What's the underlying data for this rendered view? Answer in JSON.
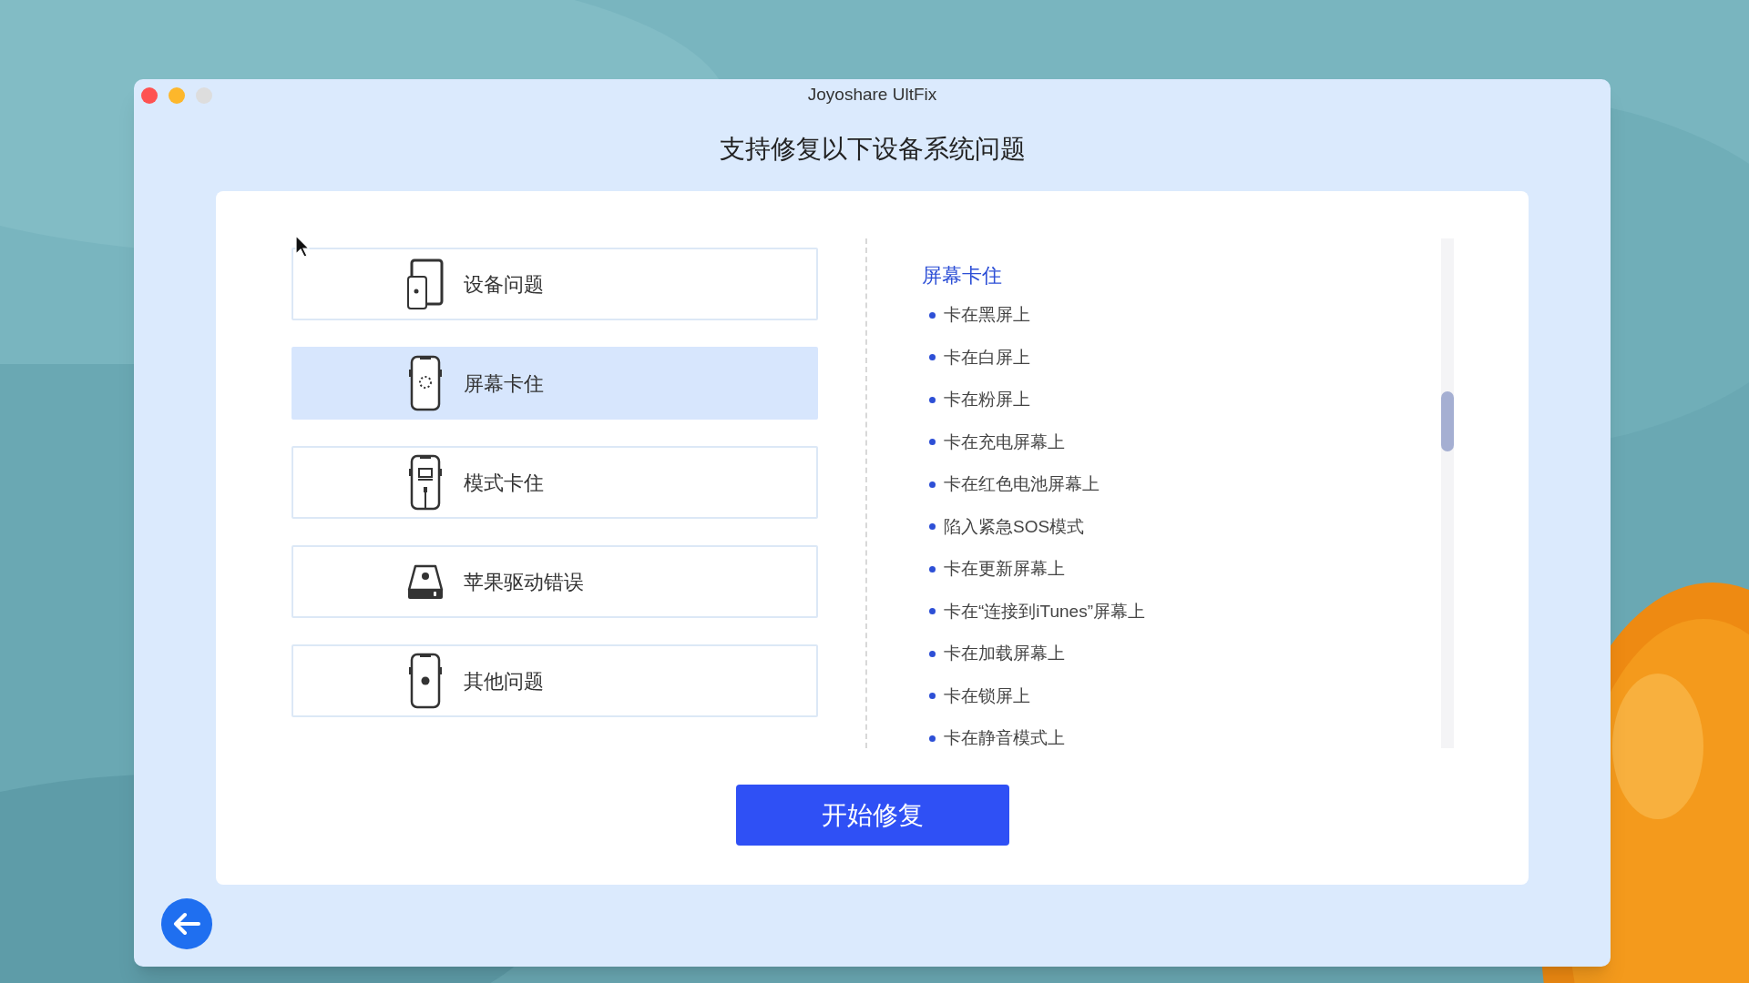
{
  "window": {
    "title": "Joyoshare UltFix"
  },
  "heading": "支持修复以下设备系统问题",
  "categories": [
    {
      "label": "设备问题",
      "kind": "devices",
      "selected": false
    },
    {
      "label": "屏幕卡住",
      "kind": "spinner",
      "selected": true
    },
    {
      "label": "模式卡住",
      "kind": "cable",
      "selected": false
    },
    {
      "label": "苹果驱动错误",
      "kind": "drive",
      "selected": false
    },
    {
      "label": "其他问题",
      "kind": "phone",
      "selected": false
    }
  ],
  "details": {
    "title": "屏幕卡住",
    "items": [
      "卡在黑屏上",
      "卡在白屏上",
      "卡在粉屏上",
      "卡在充电屏幕上",
      "卡在红色电池屏幕上",
      "陷入紧急SOS模式",
      "卡在更新屏幕上",
      "卡在“连接到iTunes”屏幕上",
      "卡在加载屏幕上",
      "卡在锁屏上",
      "卡在静音模式上"
    ]
  },
  "start_button": "开始修复"
}
